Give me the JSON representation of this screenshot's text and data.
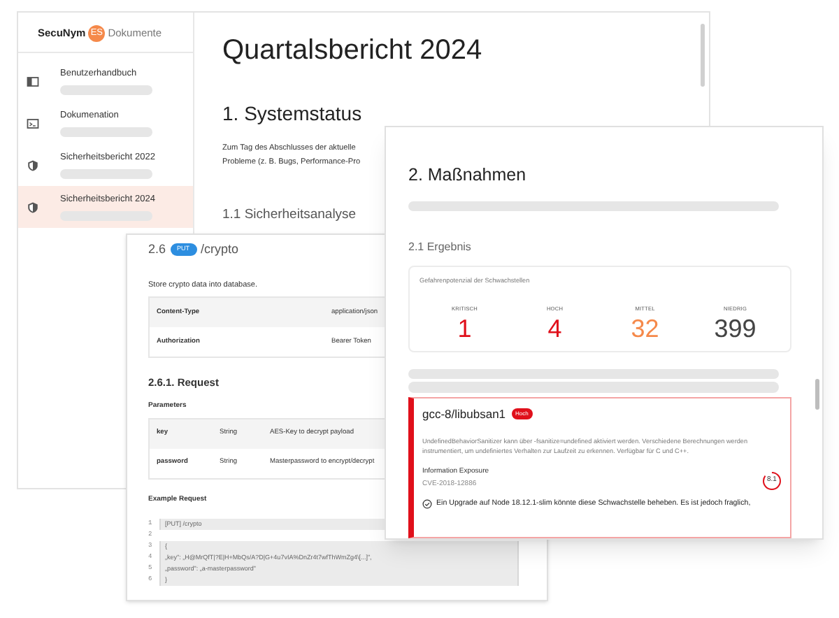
{
  "back_window": {
    "logo": {
      "brand": "SecuNym",
      "badge": "ES",
      "product": "Dokumente"
    },
    "sidebar": {
      "items": [
        {
          "label": "Benutzerhandbuch",
          "kind": "book",
          "selected": false
        },
        {
          "label": "Dokumenation",
          "kind": "terminal",
          "selected": false
        },
        {
          "label": "Sicherheitsbericht 2022",
          "kind": "shield",
          "selected": false
        },
        {
          "label": "Sicherheitsbericht 2024",
          "kind": "shield",
          "selected": true
        }
      ]
    },
    "title": "Quartalsbericht 2024",
    "section": "1. Systemstatus",
    "paragraph_lines": [
      "Zum Tag des Abschlusses der aktuelle",
      "Probleme (z. B. Bugs, Performance-Pro"
    ],
    "subsection": "1.1 Sicherheitsanalyse"
  },
  "api_window": {
    "number": "2.6",
    "method": "PUT",
    "path": "/crypto",
    "description": "Store crypto data into database.",
    "headers": [
      {
        "name": "Content-Type",
        "value": "application/json"
      },
      {
        "name": "Authorization",
        "value": "Bearer Token"
      }
    ],
    "request_heading": "2.6.1. Request",
    "parameters_heading": "Parameters",
    "parameters": [
      {
        "name": "key",
        "type": "String",
        "description": "AES-Key to decrypt payload"
      },
      {
        "name": "password",
        "type": "String",
        "description": "Masterpassword to encrypt/decrypt"
      }
    ],
    "example_heading": "Example Request",
    "code_lines": [
      {
        "number": "1",
        "text": "[PUT] /crypto"
      },
      {
        "number": "2"
      },
      {
        "number": "3",
        "text": "{"
      },
      {
        "number": "4",
        "text": "„key\": „H@MrQfT|?E|H+MbQs/A?D|G+4u7vIA%DnZr4t7wfThWmZg4\\[...]\","
      },
      {
        "number": "5",
        "text": "„password\": „a-masterpassword\""
      },
      {
        "number": "6",
        "text": "}"
      }
    ]
  },
  "report_window": {
    "title": "2. Maßnahmen",
    "subsection": "2.1 Ergebnis",
    "summary": {
      "caption": "Gefahrenpotenzial der Schwachstellen",
      "counts": [
        {
          "label": "KRITISCH",
          "value": "1",
          "color": "#e0101b"
        },
        {
          "label": "HOCH",
          "value": "4",
          "color": "#e0101b"
        },
        {
          "label": "MITTEL",
          "value": "32",
          "color": "#f5894a"
        },
        {
          "label": "NIEDRIG",
          "value": "399",
          "color": "#444444"
        }
      ]
    },
    "vulnerability": {
      "package": "gcc-8/libubsan1",
      "severity": "Hoch",
      "description": "UndefinedBehaviorSanitizer kann über -fsanitize=undefined aktiviert werden. Verschiedene Berechnungen werden instrumentiert, um undefiniertes Verhalten zur Laufzeit zu erkennen. Verfügbar für C und C++.",
      "type": "Information Exposure",
      "cve": "CVE-2018-12886",
      "score": "8.1",
      "remediation": "Ein Upgrade auf Node 18.12.1-slim könnte diese Schwachstelle beheben. Es ist jedoch fraglich,"
    }
  }
}
